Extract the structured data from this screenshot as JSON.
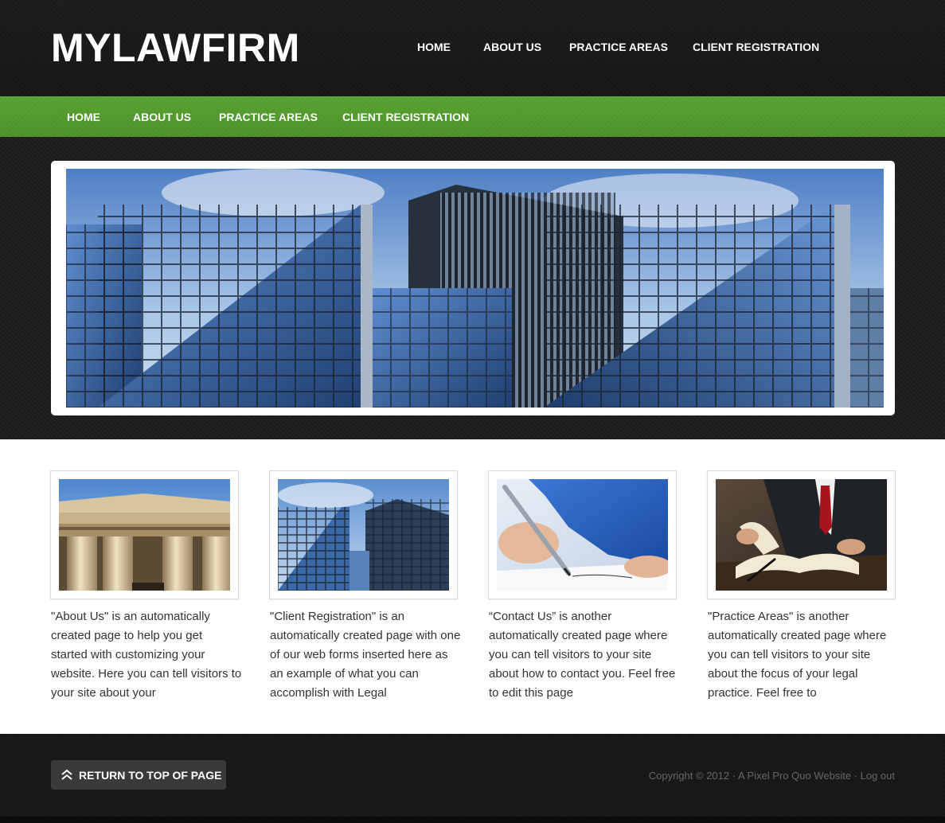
{
  "header": {
    "logo": "MYLAWFIRM",
    "nav": [
      "HOME",
      "ABOUT US",
      "PRACTICE AREAS",
      "CLIENT REGISTRATION"
    ]
  },
  "subnav": {
    "items": [
      "HOME",
      "ABOUT US",
      "PRACTICE AREAS",
      "CLIENT REGISTRATION"
    ]
  },
  "hero": {
    "image": "glass-skyscrapers-banner"
  },
  "cards": [
    {
      "image": "courthouse-columns",
      "text": "\"About Us\" is an automatically created page to help you get started with customizing your website. Here you can tell visitors to your site about your"
    },
    {
      "image": "glass-skyscrapers",
      "text": "\"Client Registration\" is an automatically created page with one of our web forms inserted here as an example of what you can accomplish with Legal"
    },
    {
      "image": "hand-signing-document",
      "text": "“Contact Us” is another automatically created page where you can tell visitors to your site about how to contact you. Feel free to edit this page"
    },
    {
      "image": "lawyer-reading-book",
      "text": "\"Practice Areas\" is another automatically created page where you can tell visitors to your site about the focus of your legal practice. Feel free to"
    }
  ],
  "footer": {
    "return_label": "RETURN TO TOP OF PAGE",
    "return_icon": "double-chevron-up-icon",
    "copyright": "Copyright © 2012 · ",
    "site_link": "A Pixel Pro Quo Website",
    "separator": " · ",
    "logout": "Log out"
  },
  "colors": {
    "header_bg": "#161616",
    "nav_green": "#4f992b",
    "text": "#333333",
    "footer_text": "#666666",
    "button_bg": "#3a3a3a"
  }
}
